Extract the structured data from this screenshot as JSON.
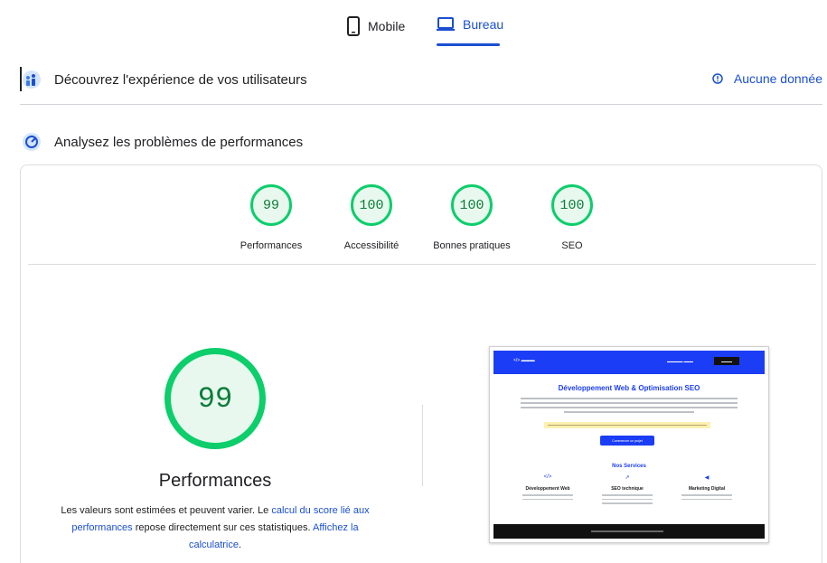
{
  "tabs": {
    "mobile_label": "Mobile",
    "desktop_label": "Bureau",
    "active": "Bureau"
  },
  "section_experience": {
    "title": "Découvrez l'expérience de vos utilisateurs",
    "no_data_label": "Aucune donnée"
  },
  "section_diagnostics": {
    "title": "Analysez les problèmes de performances"
  },
  "scores": [
    {
      "label": "Performances",
      "value": "99"
    },
    {
      "label": "Accessibilité",
      "value": "100"
    },
    {
      "label": "Bonnes pratiques",
      "value": "100"
    },
    {
      "label": "SEO",
      "value": "100"
    }
  ],
  "main_score": {
    "value": "99",
    "title": "Performances",
    "desc_part1": "Les valeurs sont estimées et peuvent varier. Le ",
    "desc_link1": "calcul du score lié aux performances",
    "desc_part2": " repose directement sur ces statistiques. ",
    "desc_link2": "Affichez la calculatrice",
    "desc_part3": "."
  },
  "screenshot": {
    "headline": "Développement Web & Optimisation SEO",
    "cta": "Commencer un projet",
    "services_title": "Nos Services",
    "services": [
      {
        "title": "Développement Web",
        "icon": "code-icon"
      },
      {
        "title": "SEO technique",
        "icon": "chart-icon"
      },
      {
        "title": "Marketing Digital",
        "icon": "megaphone-icon"
      }
    ]
  },
  "colors": {
    "accent": "#1a4fd1",
    "pass": "#0cce6b",
    "pass_text": "#0a7d39"
  }
}
